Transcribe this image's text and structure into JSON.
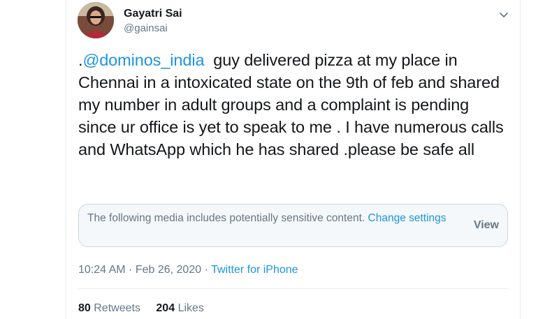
{
  "user": {
    "name": "Gayatri Sai",
    "handle": "@gainsai"
  },
  "icons": {
    "more": "chevron-down-icon",
    "avatar": "profile-photo"
  },
  "tweet": {
    "prefix": ".",
    "mention": "@dominos_india",
    "body": "  guy delivered pizza at my place in Chennai in a intoxicated state on the 9th of feb and shared my number in adult groups and a complaint is pending since ur office is yet to speak to me . I have numerous calls and WhatsApp which he has shared .please be safe all"
  },
  "sensitive_notice": {
    "text": "The following media includes potentially sensitive content. ",
    "link": "Change settings",
    "view_label": "View"
  },
  "meta": {
    "time": "10:24 AM",
    "separator": " · ",
    "date": "Feb 26, 2020",
    "source": "Twitter for iPhone"
  },
  "stats": {
    "retweets_count": "80",
    "retweets_label": "Retweets",
    "likes_count": "204",
    "likes_label": "Likes"
  },
  "colors": {
    "link": "#1b95e0",
    "secondary_text": "#657786",
    "primary_text": "#14171a",
    "notice_bg": "#f5f8fa"
  }
}
